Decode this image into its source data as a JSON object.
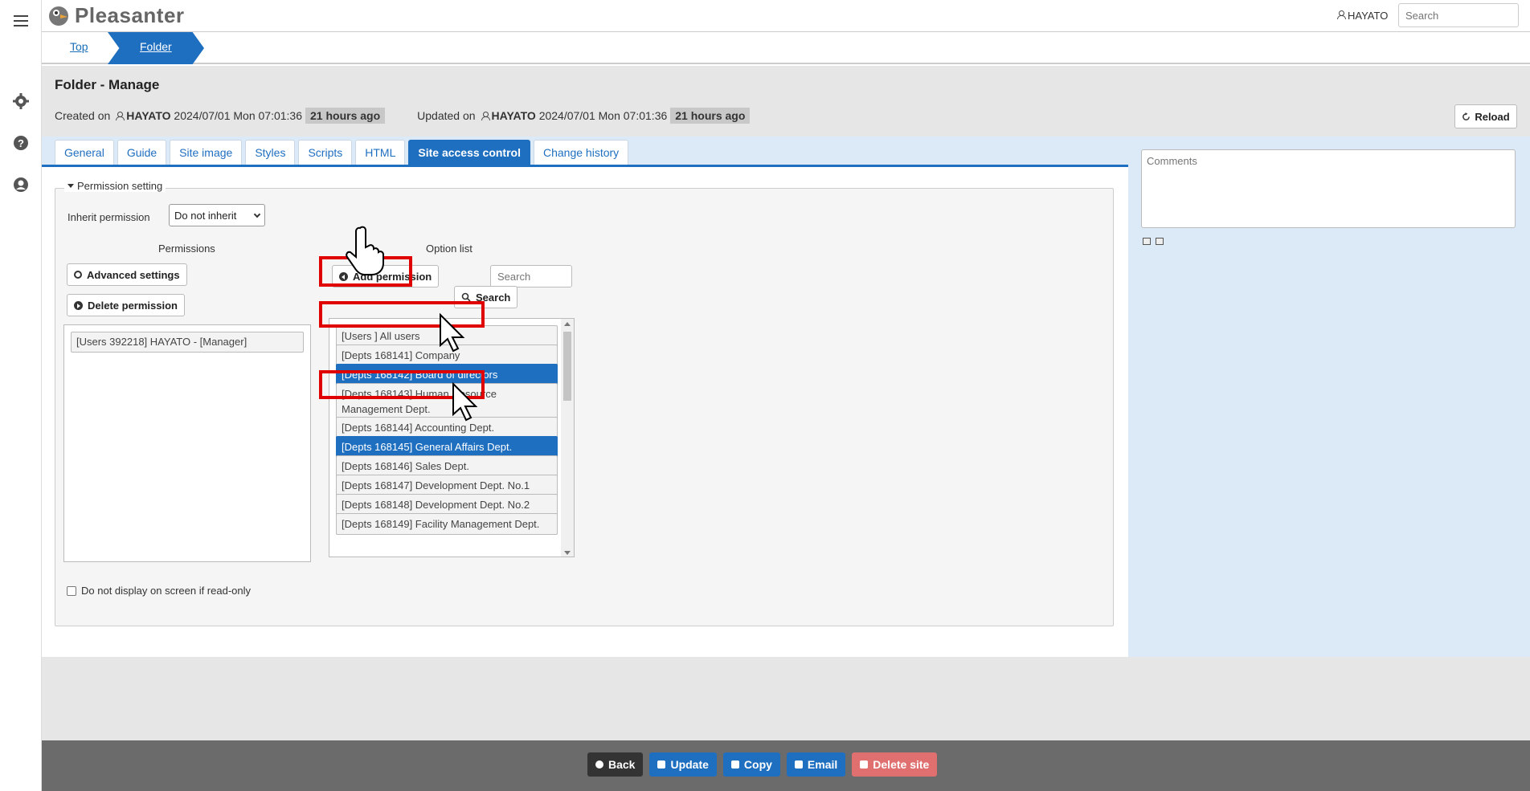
{
  "app": {
    "name": "Pleasanter"
  },
  "header": {
    "user": "HAYATO",
    "search_placeholder": "Search"
  },
  "breadcrumb": {
    "top": "Top",
    "current": "Folder"
  },
  "page": {
    "title": "Folder - Manage",
    "created_label": "Created on",
    "created_user": "HAYATO",
    "created_date": "2024/07/01 Mon 07:01:36",
    "created_ago": "21 hours ago",
    "updated_label": "Updated on",
    "updated_user": "HAYATO",
    "updated_date": "2024/07/01 Mon 07:01:36",
    "updated_ago": "21 hours ago",
    "reload_label": "Reload"
  },
  "tabs": [
    {
      "label": "General",
      "active": false
    },
    {
      "label": "Guide",
      "active": false
    },
    {
      "label": "Site image",
      "active": false
    },
    {
      "label": "Styles",
      "active": false
    },
    {
      "label": "Scripts",
      "active": false
    },
    {
      "label": "HTML",
      "active": false
    },
    {
      "label": "Site access control",
      "active": true
    },
    {
      "label": "Change history",
      "active": false
    }
  ],
  "comments": {
    "placeholder": "Comments"
  },
  "permission_setting": {
    "legend": "Permission setting",
    "inherit_label": "Inherit permission",
    "inherit_value": "Do not inherit",
    "permissions_heading": "Permissions",
    "option_heading": "Option list",
    "advanced_settings_label": "Advanced settings",
    "delete_permission_label": "Delete permission",
    "add_permission_label": "Add permission",
    "search_placeholder": "Search",
    "search_button_label": "Search",
    "permissions": [
      "[Users 392218] HAYATO - [Manager]"
    ],
    "options": [
      {
        "label": "[Users ] All users",
        "selected": false
      },
      {
        "label": "[Depts 168141] Company",
        "selected": false
      },
      {
        "label": "[Depts 168142] Board of directors",
        "selected": true
      },
      {
        "label": "[Depts 168143] Human Resource Management Dept.",
        "selected": false
      },
      {
        "label": "[Depts 168144] Accounting Dept.",
        "selected": false
      },
      {
        "label": "[Depts 168145] General Affairs Dept.",
        "selected": true
      },
      {
        "label": "[Depts 168146] Sales Dept.",
        "selected": false
      },
      {
        "label": "[Depts 168147] Development Dept. No.1",
        "selected": false
      },
      {
        "label": "[Depts 168148] Development Dept. No.2",
        "selected": false
      },
      {
        "label": "[Depts 168149] Facility Management Dept.",
        "selected": false
      }
    ],
    "readonly_label": "Do not display on screen if read-only"
  },
  "footer": {
    "back": "Back",
    "update": "Update",
    "copy": "Copy",
    "email": "Email",
    "delete_site": "Delete site"
  },
  "colors": {
    "primary": "#1f6fc0",
    "danger": "#e07070",
    "dark_button": "#333333",
    "annotation": "#e00000"
  }
}
